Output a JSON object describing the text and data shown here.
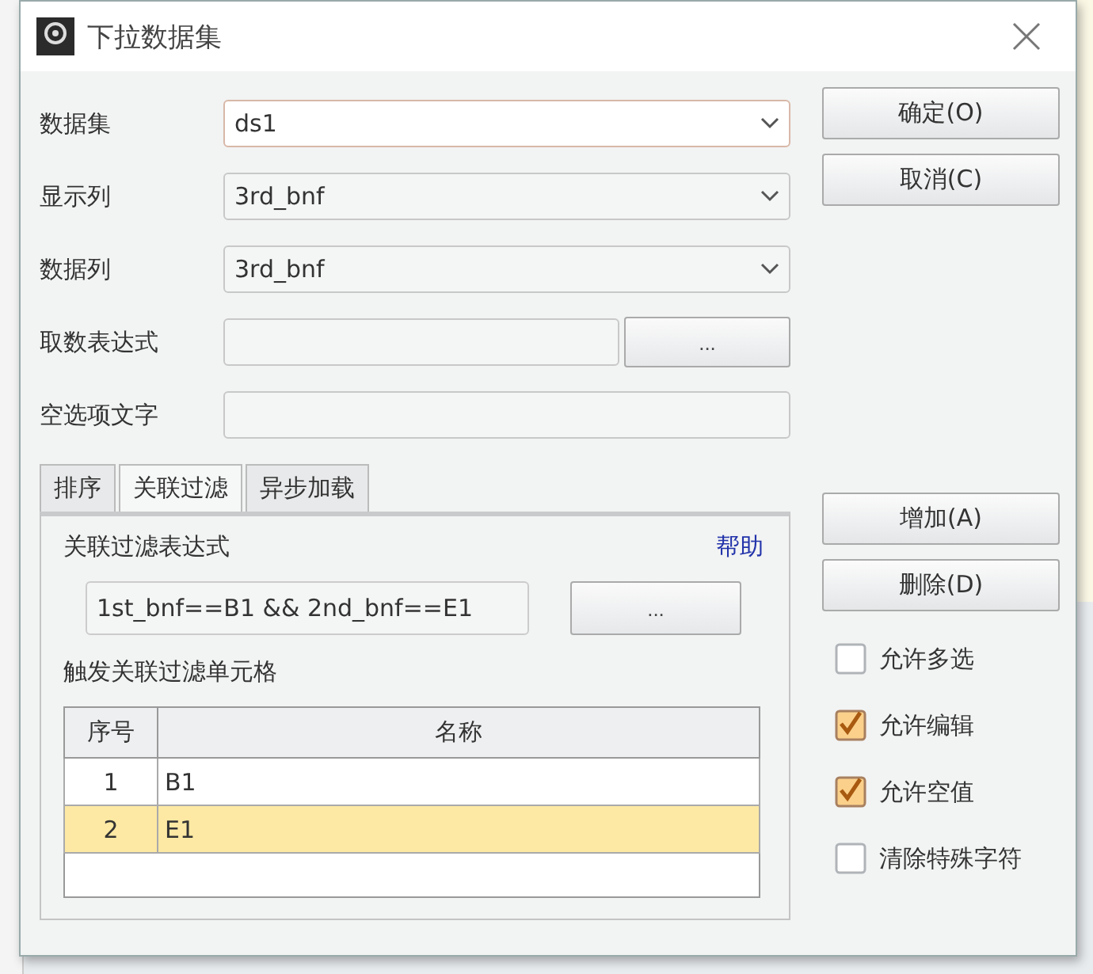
{
  "window": {
    "title": "下拉数据集"
  },
  "fields": [
    {
      "label": "数据集",
      "kind": "select",
      "value": "ds1",
      "focused": true
    },
    {
      "label": "显示列",
      "kind": "select",
      "value": "3rd_bnf",
      "focused": false
    },
    {
      "label": "数据列",
      "kind": "select",
      "value": "3rd_bnf",
      "focused": false
    },
    {
      "label": "取数表达式",
      "kind": "browse",
      "button": "...",
      "focused": false
    },
    {
      "label": "空选项文字",
      "kind": "text",
      "focused": false
    }
  ],
  "tabs": [
    {
      "label": "排序",
      "selected": false
    },
    {
      "label": "关联过滤",
      "selected": true
    },
    {
      "label": "异步加载",
      "selected": false
    }
  ],
  "filter": {
    "label": "关联过滤表达式",
    "help": "帮助",
    "expression": "1st_bnf==B1 && 2nd_bnf==E1",
    "button": "..."
  },
  "table": {
    "title": "触发关联过滤单元格",
    "columns": [
      "序号",
      "名称"
    ],
    "rows": [
      {
        "cells": [
          "1",
          "B1"
        ],
        "selected": false
      },
      {
        "cells": [
          "2",
          "E1"
        ],
        "selected": true
      }
    ]
  },
  "top_buttons": [
    {
      "label": "确定(O)"
    },
    {
      "label": "取消(C)"
    }
  ],
  "row_buttons": [
    {
      "label": "增加(A)"
    },
    {
      "label": "删除(D)"
    }
  ],
  "options": [
    {
      "label": "允许多选",
      "checked": false
    },
    {
      "label": "允许编辑",
      "checked": true
    },
    {
      "label": "允许空值",
      "checked": true
    },
    {
      "label": "清除特殊字符",
      "checked": false
    }
  ]
}
